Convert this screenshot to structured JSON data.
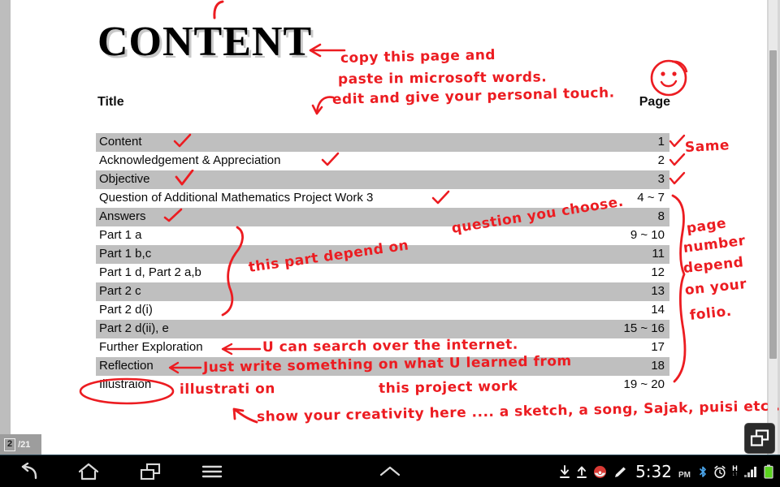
{
  "document": {
    "title": "CONTENT",
    "header": {
      "title_label": "Title",
      "page_label": "Page"
    },
    "rows": [
      {
        "name": "Content",
        "page": "1"
      },
      {
        "name": "Acknowledgement & Appreciation",
        "page": "2"
      },
      {
        "name": "Objective",
        "page": "3"
      },
      {
        "name": "Question of Additional Mathematics Project Work 3",
        "page": "4 ~ 7"
      },
      {
        "name": "Answers",
        "page": "8"
      },
      {
        "name": "Part 1 a",
        "page": "9 ~ 10"
      },
      {
        "name": "Part 1 b,c",
        "page": "11"
      },
      {
        "name": "Part 1 d, Part 2 a,b",
        "page": "12"
      },
      {
        "name": "Part 2 c",
        "page": "13"
      },
      {
        "name": "Part 2 d(i)",
        "page": "14"
      },
      {
        "name": "Part 2 d(ii), e",
        "page": "15 ~ 16"
      },
      {
        "name": "Further Exploration",
        "page": "17"
      },
      {
        "name": "Reflection",
        "page": "18"
      },
      {
        "name": "Illustraion",
        "page": "19 ~ 20"
      }
    ]
  },
  "annotations": {
    "copy_line1": "copy this page  and",
    "copy_line2": "paste in  microsoft words.",
    "edit_line": "edit  and  give your  personal  touch.",
    "same": "Same",
    "this_part": "this part  depend on",
    "question_choose": "question you choose.",
    "page_number_folio": [
      "page",
      "number",
      "depend",
      "on your",
      "folio."
    ],
    "internet": "U can  search  over  the  internet.",
    "reflection_line1": "Just write  something  on  what  U  learned from",
    "reflection_line2": "this project   work",
    "illustration_fix": "illustrati on",
    "creativity": "show  your  creativity  here ....  a sketch, a song, Sajak, puisi etc..."
  },
  "ink_color": "#ec1c21",
  "viewer": {
    "current_page": "2",
    "total_pages": "/21"
  },
  "system_bar": {
    "back_icon": "back-arrow-icon",
    "home_icon": "home-icon",
    "recents_icon": "recent-apps-icon",
    "menu_icon": "menu-icon",
    "assist_icon": "assist-caret-icon",
    "download_icon": "download-icon",
    "upload_icon": "upload-icon",
    "notification_icon": "notification-circle-icon",
    "pen_icon": "pen-icon",
    "time": "5:32",
    "ampm": "PM",
    "bluetooth_icon": "bluetooth-icon",
    "alarm_icon": "alarm-clock-icon",
    "network_type": "H",
    "network_arrows": "↓↑",
    "signal_icon": "signal-bars-icon",
    "battery_icon": "battery-icon"
  },
  "float_button": {
    "icon": "overlapping-windows-icon"
  }
}
